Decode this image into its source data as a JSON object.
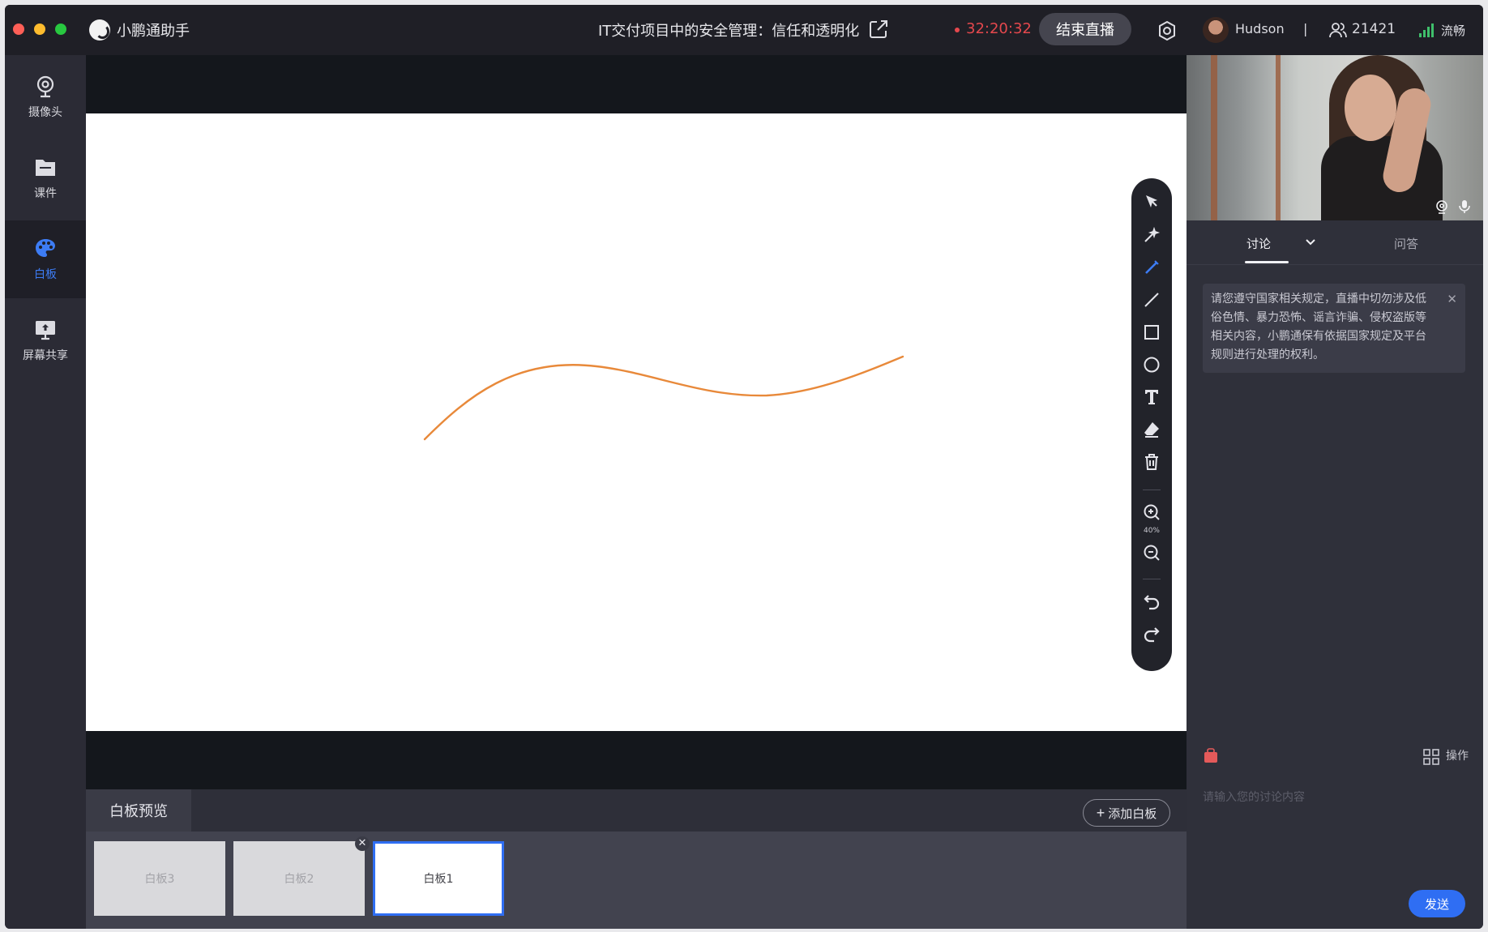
{
  "titlebar": {
    "app_name": "小鹏通助手",
    "room_title": "IT交付项目中的安全管理：信任和透明化",
    "timer": "32:20:32",
    "end_live_label": "结束直播",
    "username": "Hudson",
    "separator": "|",
    "viewer_count": "21421",
    "network_status": "流畅"
  },
  "sidebar": {
    "items": [
      {
        "label": "摄像头",
        "icon": "webcam-icon"
      },
      {
        "label": "课件",
        "icon": "folder-icon"
      },
      {
        "label": "白板",
        "icon": "palette-icon",
        "active": true
      },
      {
        "label": "屏幕共享",
        "icon": "screen-share-icon"
      }
    ]
  },
  "toolbar": {
    "zoom_level": "40%",
    "tools": [
      "select-cursor-icon",
      "laser-pointer-icon",
      "pen-icon",
      "line-icon",
      "rectangle-icon",
      "circle-icon",
      "text-icon",
      "eraser-icon",
      "trash-icon",
      "zoom-in-icon",
      "zoom-out-icon",
      "undo-icon",
      "redo-icon"
    ],
    "active_tool": "pen-icon"
  },
  "board": {
    "stroke_color": "#e8893a"
  },
  "preview": {
    "tab_label": "白板预览",
    "add_label": "添加白板",
    "thumbs": [
      {
        "label": "白板3"
      },
      {
        "label": "白板2"
      },
      {
        "label": "白板1",
        "active": true
      }
    ]
  },
  "right_panel": {
    "tab_discussion": "讨论",
    "tab_qa": "问答",
    "notice": "请您遵守国家相关规定，直播中切勿涉及低俗色情、暴力恐怖、谣言诈骗、侵权盗版等相关内容，小鹏通保有依据国家规定及平台规则进行处理的权利。",
    "ops_label": "操作",
    "input_placeholder": "请输入您的讨论内容",
    "send_label": "发送"
  },
  "colors": {
    "accent": "#2f6ef3",
    "record_red": "#e5484d",
    "signal_green": "#3fbf6b"
  }
}
